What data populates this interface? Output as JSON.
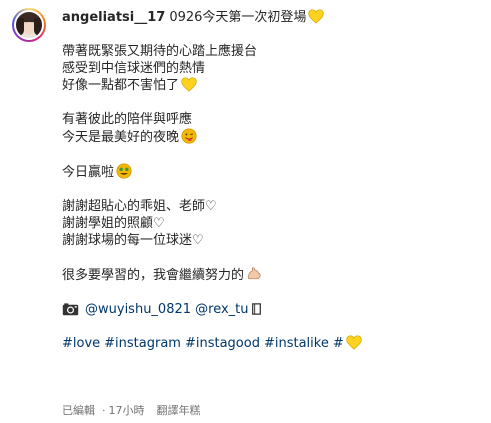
{
  "post": {
    "username": "angeliatsi__17",
    "first_line_text": "0926今天第一次初登場",
    "lines": [
      "帶著既緊張又期待的心踏上應援台",
      "感受到中信球迷們的熱情",
      "好像一點都不害怕了",
      "有著彼此的陪伴與呼應",
      "今天是最美好的夜晚",
      "今日贏啦",
      "謝謝超貼心的乖姐、老師♡",
      "謝謝學姐的照顧♡",
      "謝謝球場的每一位球迷♡",
      "很多要學習的，我會繼續努力的"
    ],
    "mentions": [
      "@wuyishu_0821",
      "@rex_tu"
    ],
    "hashtags": [
      "#love",
      "#instagram",
      "#instagood",
      "#instalike",
      "#"
    ]
  },
  "meta": {
    "edited": "已編輯",
    "separator": "·",
    "time": "17小時",
    "translate": "翻譯年糕"
  },
  "icons": {
    "heart": "yellow-heart-icon",
    "face": "smiling-face-icon",
    "muscle": "flexed-biceps-icon",
    "camera": "camera-icon"
  },
  "colors": {
    "text": "#262626",
    "link": "#00376b",
    "muted": "#737373",
    "heart_yellow": "#ffd21f"
  }
}
